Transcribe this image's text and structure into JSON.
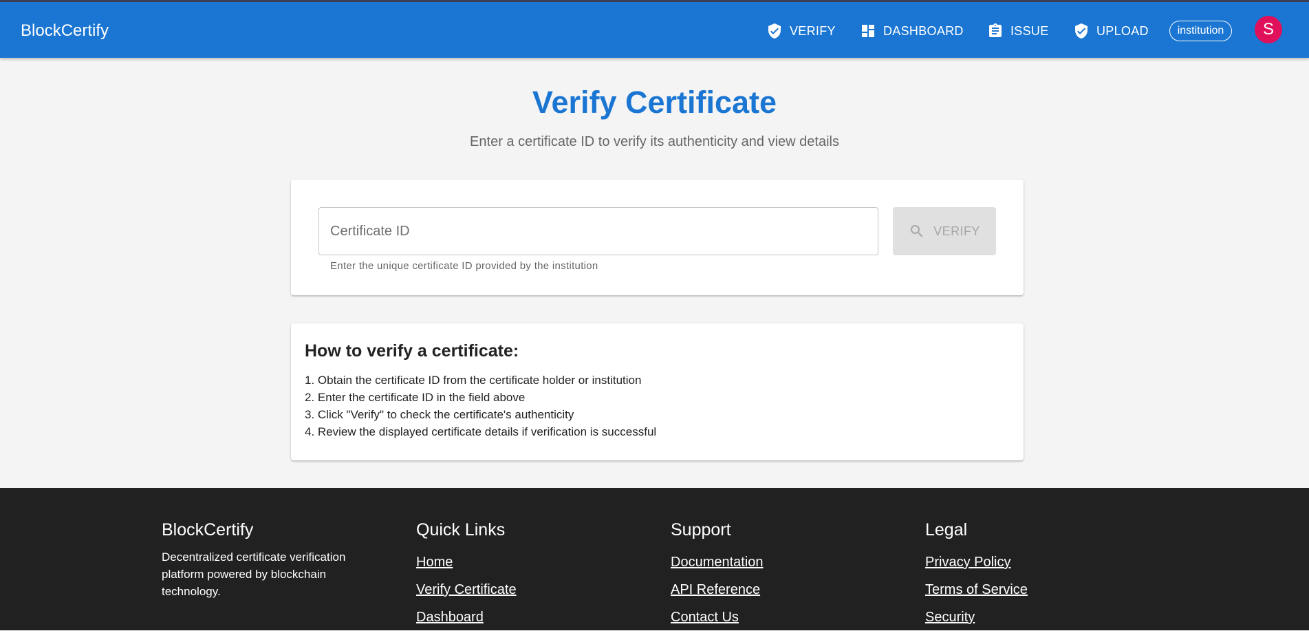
{
  "appbar": {
    "brand": "BlockCertify",
    "nav": [
      {
        "label": "VERIFY",
        "icon": "verified-shield-icon"
      },
      {
        "label": "DASHBOARD",
        "icon": "dashboard-icon"
      },
      {
        "label": "ISSUE",
        "icon": "assignment-icon"
      },
      {
        "label": "UPLOAD",
        "icon": "verified-shield-icon"
      }
    ],
    "role": "institution",
    "avatar_initial": "S"
  },
  "colors": {
    "primary": "#1a76d2",
    "avatar": "#e0105a",
    "footer": "#212121"
  },
  "main": {
    "title": "Verify Certificate",
    "subtitle": "Enter a certificate ID to verify its authenticity and view details",
    "input": {
      "placeholder": "Certificate ID",
      "value": "",
      "helper": "Enter the unique certificate ID provided by the institution"
    },
    "verify_button": {
      "label": "VERIFY",
      "icon": "search-icon",
      "disabled": true
    }
  },
  "howto": {
    "title": "How to verify a certificate:",
    "steps": [
      "1. Obtain the certificate ID from the certificate holder or institution",
      "2. Enter the certificate ID in the field above",
      "3. Click \"Verify\" to check the certificate's authenticity",
      "4. Review the displayed certificate details if verification is successful"
    ]
  },
  "footer": {
    "about": {
      "title": "BlockCertify",
      "text": "Decentralized certificate verification platform powered by blockchain technology."
    },
    "quick_links": {
      "title": "Quick Links",
      "links": [
        "Home",
        "Verify Certificate",
        "Dashboard"
      ]
    },
    "support": {
      "title": "Support",
      "links": [
        "Documentation",
        "API Reference",
        "Contact Us"
      ]
    },
    "legal": {
      "title": "Legal",
      "links": [
        "Privacy Policy",
        "Terms of Service",
        "Security"
      ]
    }
  }
}
